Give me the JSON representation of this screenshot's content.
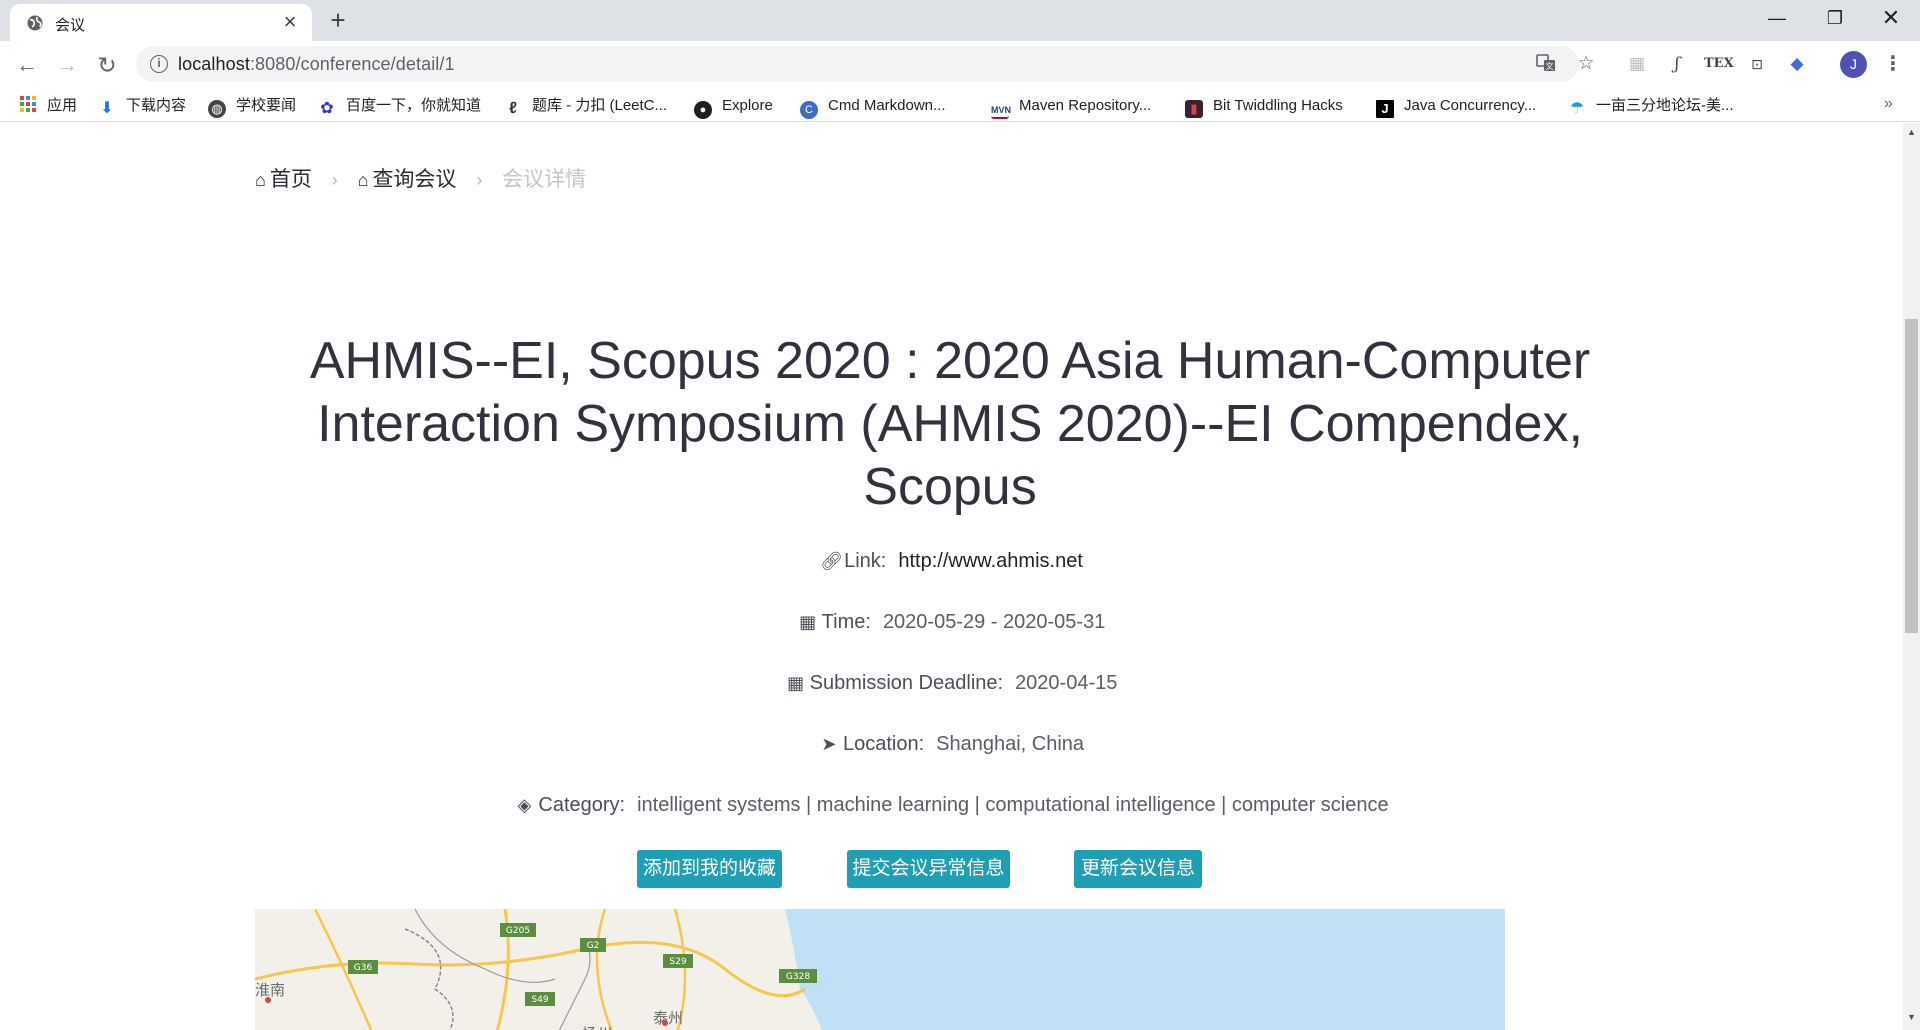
{
  "browser": {
    "tab_title": "会议",
    "url_host": "localhost",
    "url_rest": ":8080/conference/detail/1",
    "bookmarks": [
      {
        "label": "应用",
        "icon": "apps-grid-icon"
      },
      {
        "label": "下载内容",
        "icon": "download-icon"
      },
      {
        "label": "学校要闻",
        "icon": "globe-icon"
      },
      {
        "label": "百度一下，你就知道",
        "icon": "baidu-paw-icon"
      },
      {
        "label": "题库 - 力扣 (LeetC...",
        "icon": "leetcode-icon"
      },
      {
        "label": "Explore",
        "icon": "github-icon"
      },
      {
        "label": "Cmd Markdown...",
        "icon": "cmd-markdown-icon"
      },
      {
        "label": "Maven Repository...",
        "icon": "mvn-icon"
      },
      {
        "label": "Bit Twiddling Hacks",
        "icon": "bit-twiddling-icon"
      },
      {
        "label": "Java Concurrency...",
        "icon": "java-j-icon"
      },
      {
        "label": "一亩三分地论坛-美...",
        "icon": "1point3acres-icon"
      }
    ],
    "avatar_letter": "J"
  },
  "breadcrumb": {
    "home": "首页",
    "query": "查询会议",
    "current": "会议详情"
  },
  "conference": {
    "title": "AHMIS--EI, Scopus 2020 : 2020 Asia Human-Computer Interaction Symposium (AHMIS 2020)--EI Compendex, Scopus",
    "link_label": "Link:",
    "link": "http://www.ahmis.net",
    "time_label": "Time:",
    "time": "2020-05-29 - 2020-05-31",
    "deadline_label": "Submission Deadline:",
    "deadline": "2020-04-15",
    "location_label": "Location:",
    "location": "Shanghai, China",
    "category_label": "Category:",
    "category": "intelligent systems | machine learning | computational intelligence | computer science"
  },
  "actions": {
    "favorite": "添加到我的收藏",
    "report": "提交会议异常信息",
    "update": "更新会议信息"
  },
  "map": {
    "road_labels": [
      "G36",
      "G205",
      "G2",
      "S29",
      "G328",
      "S49"
    ],
    "place_labels": [
      "淮南",
      "扬州",
      "泰州"
    ],
    "colors": {
      "land": "#f3f0e9",
      "sea": "#bfe0f5",
      "road": "#f7c64a",
      "highway_shield": "#5b8e3e"
    }
  },
  "colors": {
    "accent_button": "#1e9fb4",
    "title_text": "#32323f"
  }
}
